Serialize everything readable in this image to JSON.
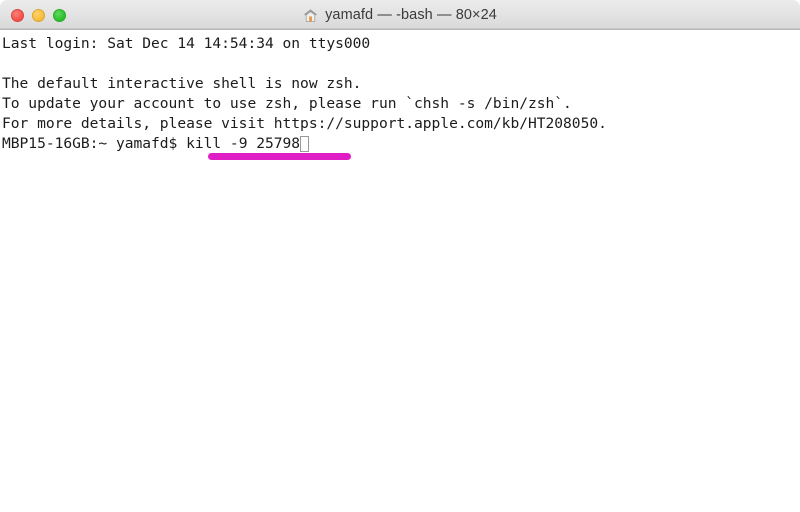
{
  "window": {
    "title": "yamafd — -bash — 80×24",
    "icon": "home-icon",
    "controls": {
      "close": "close",
      "minimize": "minimize",
      "zoom": "zoom"
    },
    "colors": {
      "close": "#f4564c",
      "minimize": "#f7bd3e",
      "zoom": "#2fc22f",
      "titlebar": "#e4e4e4",
      "body": "#ffffff",
      "text": "#1c1c1c",
      "annotation": "#e01ec6"
    }
  },
  "terminal": {
    "lines": [
      "Last login: Sat Dec 14 14:54:34 on ttys000",
      "",
      "The default interactive shell is now zsh.",
      "To update your account to use zsh, please run `chsh -s /bin/zsh`.",
      "For more details, please visit https://support.apple.com/kb/HT208050."
    ],
    "prompt": "MBP15-16GB:~ yamafd$ ",
    "command": "kill -9 25798",
    "cursor": "block-cursor"
  },
  "annotation": {
    "type": "underline",
    "target": "kill -9 25798",
    "color": "#e01ec6"
  }
}
